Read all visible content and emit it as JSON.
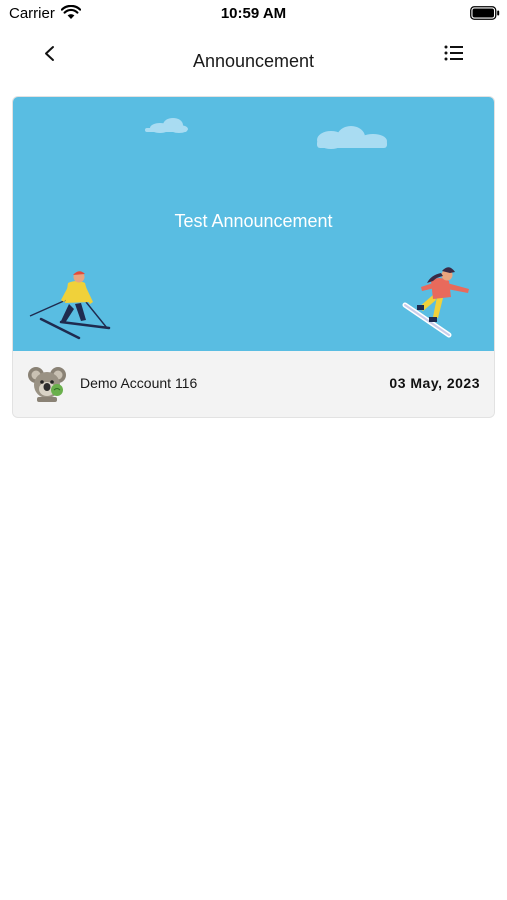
{
  "status_bar": {
    "carrier": "Carrier",
    "time": "10:59 AM",
    "wifi_icon": "wifi-icon",
    "battery_icon": "battery-icon"
  },
  "nav": {
    "title": "Announcement",
    "back_icon": "chevron-left-icon",
    "menu_icon": "list-icon"
  },
  "announcement": {
    "title": "Test Announcement",
    "author": "Demo Account 116",
    "date": "03 May, 2023",
    "banner_color": "#59bde2",
    "avatar_icon": "koala-avatar-icon"
  }
}
